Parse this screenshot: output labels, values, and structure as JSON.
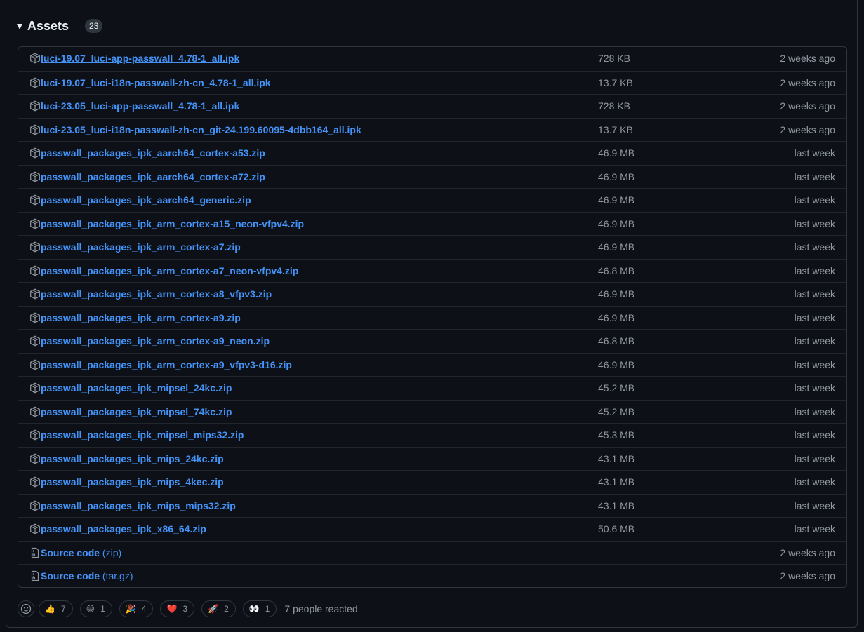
{
  "assets": {
    "title": "Assets",
    "count": "23",
    "items": [
      {
        "name": "luci-19.07_luci-app-passwall_4.78-1_all.ipk",
        "suffix": "",
        "size": "728 KB",
        "date": "2 weeks ago",
        "icon": "package-icon",
        "hovered": true
      },
      {
        "name": "luci-19.07_luci-i18n-passwall-zh-cn_4.78-1_all.ipk",
        "suffix": "",
        "size": "13.7 KB",
        "date": "2 weeks ago",
        "icon": "package-icon"
      },
      {
        "name": "luci-23.05_luci-app-passwall_4.78-1_all.ipk",
        "suffix": "",
        "size": "728 KB",
        "date": "2 weeks ago",
        "icon": "package-icon"
      },
      {
        "name": "luci-23.05_luci-i18n-passwall-zh-cn_git-24.199.60095-4dbb164_all.ipk",
        "suffix": "",
        "size": "13.7 KB",
        "date": "2 weeks ago",
        "icon": "package-icon"
      },
      {
        "name": "passwall_packages_ipk_aarch64_cortex-a53.zip",
        "suffix": "",
        "size": "46.9 MB",
        "date": "last week",
        "icon": "package-icon"
      },
      {
        "name": "passwall_packages_ipk_aarch64_cortex-a72.zip",
        "suffix": "",
        "size": "46.9 MB",
        "date": "last week",
        "icon": "package-icon"
      },
      {
        "name": "passwall_packages_ipk_aarch64_generic.zip",
        "suffix": "",
        "size": "46.9 MB",
        "date": "last week",
        "icon": "package-icon"
      },
      {
        "name": "passwall_packages_ipk_arm_cortex-a15_neon-vfpv4.zip",
        "suffix": "",
        "size": "46.9 MB",
        "date": "last week",
        "icon": "package-icon"
      },
      {
        "name": "passwall_packages_ipk_arm_cortex-a7.zip",
        "suffix": "",
        "size": "46.9 MB",
        "date": "last week",
        "icon": "package-icon"
      },
      {
        "name": "passwall_packages_ipk_arm_cortex-a7_neon-vfpv4.zip",
        "suffix": "",
        "size": "46.8 MB",
        "date": "last week",
        "icon": "package-icon"
      },
      {
        "name": "passwall_packages_ipk_arm_cortex-a8_vfpv3.zip",
        "suffix": "",
        "size": "46.9 MB",
        "date": "last week",
        "icon": "package-icon"
      },
      {
        "name": "passwall_packages_ipk_arm_cortex-a9.zip",
        "suffix": "",
        "size": "46.9 MB",
        "date": "last week",
        "icon": "package-icon"
      },
      {
        "name": "passwall_packages_ipk_arm_cortex-a9_neon.zip",
        "suffix": "",
        "size": "46.8 MB",
        "date": "last week",
        "icon": "package-icon"
      },
      {
        "name": "passwall_packages_ipk_arm_cortex-a9_vfpv3-d16.zip",
        "suffix": "",
        "size": "46.9 MB",
        "date": "last week",
        "icon": "package-icon"
      },
      {
        "name": "passwall_packages_ipk_mipsel_24kc.zip",
        "suffix": "",
        "size": "45.2 MB",
        "date": "last week",
        "icon": "package-icon"
      },
      {
        "name": "passwall_packages_ipk_mipsel_74kc.zip",
        "suffix": "",
        "size": "45.2 MB",
        "date": "last week",
        "icon": "package-icon"
      },
      {
        "name": "passwall_packages_ipk_mipsel_mips32.zip",
        "suffix": "",
        "size": "45.3 MB",
        "date": "last week",
        "icon": "package-icon"
      },
      {
        "name": "passwall_packages_ipk_mips_24kc.zip",
        "suffix": "",
        "size": "43.1 MB",
        "date": "last week",
        "icon": "package-icon"
      },
      {
        "name": "passwall_packages_ipk_mips_4kec.zip",
        "suffix": "",
        "size": "43.1 MB",
        "date": "last week",
        "icon": "package-icon"
      },
      {
        "name": "passwall_packages_ipk_mips_mips32.zip",
        "suffix": "",
        "size": "43.1 MB",
        "date": "last week",
        "icon": "package-icon"
      },
      {
        "name": "passwall_packages_ipk_x86_64.zip",
        "suffix": "",
        "size": "50.6 MB",
        "date": "last week",
        "icon": "package-icon"
      },
      {
        "name": "Source code",
        "suffix": " (zip)",
        "size": "",
        "date": "2 weeks ago",
        "icon": "file-zip-icon"
      },
      {
        "name": "Source code",
        "suffix": " (tar.gz)",
        "size": "",
        "date": "2 weeks ago",
        "icon": "file-zip-icon"
      }
    ]
  },
  "reactions": {
    "items": [
      {
        "emoji": "👍",
        "name": "thumbs-up",
        "count": "7"
      },
      {
        "emoji": "😄",
        "name": "laugh",
        "count": "1"
      },
      {
        "emoji": "🎉",
        "name": "hooray",
        "count": "4"
      },
      {
        "emoji": "❤️",
        "name": "heart",
        "count": "3"
      },
      {
        "emoji": "🚀",
        "name": "rocket",
        "count": "2"
      },
      {
        "emoji": "👀",
        "name": "eyes",
        "count": "1"
      }
    ],
    "summary": "7 people reacted"
  },
  "colors": {
    "background": "#0d1117",
    "border": "#30363d",
    "link": "#4493f8",
    "muted": "#9198a1"
  }
}
